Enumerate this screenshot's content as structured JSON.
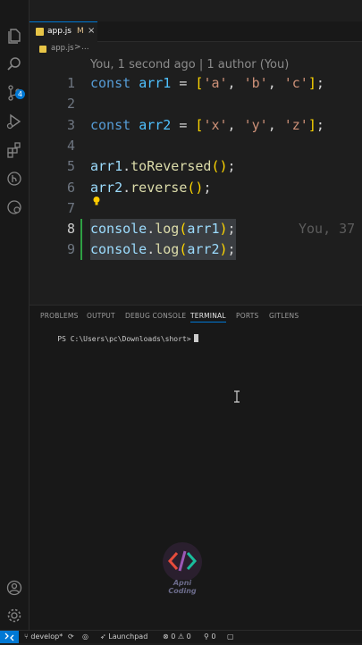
{
  "tab": {
    "filename": "app.js",
    "modified_flag": "M",
    "close_glyph": "×"
  },
  "breadcrumb": {
    "filename": "app.js",
    "separator": ">",
    "more": "..."
  },
  "editor": {
    "codelens": "You, 1 second ago | 1 author (You)",
    "blame": "You, 37",
    "lines": [
      {
        "n": "1",
        "tokens": [
          [
            "k",
            "const "
          ],
          [
            "v",
            "arr1"
          ],
          [
            "p",
            " = "
          ],
          [
            "b1",
            "["
          ],
          [
            "s",
            "'a'"
          ],
          [
            "p",
            ", "
          ],
          [
            "s",
            "'b'"
          ],
          [
            "p",
            ", "
          ],
          [
            "s",
            "'c'"
          ],
          [
            "b1",
            "]"
          ],
          [
            "p",
            ";"
          ]
        ]
      },
      {
        "n": "2",
        "tokens": []
      },
      {
        "n": "3",
        "tokens": [
          [
            "k",
            "const "
          ],
          [
            "v",
            "arr2"
          ],
          [
            "p",
            " = "
          ],
          [
            "b1",
            "["
          ],
          [
            "s",
            "'x'"
          ],
          [
            "p",
            ", "
          ],
          [
            "s",
            "'y'"
          ],
          [
            "p",
            ", "
          ],
          [
            "s",
            "'z'"
          ],
          [
            "b1",
            "]"
          ],
          [
            "p",
            ";"
          ]
        ]
      },
      {
        "n": "4",
        "tokens": []
      },
      {
        "n": "5",
        "tokens": [
          [
            "vl",
            "arr1"
          ],
          [
            "p",
            "."
          ],
          [
            "f",
            "toReversed"
          ],
          [
            "b1",
            "()"
          ],
          [
            "p",
            ";"
          ]
        ]
      },
      {
        "n": "6",
        "tokens": [
          [
            "vl",
            "arr2"
          ],
          [
            "p",
            "."
          ],
          [
            "f",
            "reverse"
          ],
          [
            "b1",
            "()"
          ],
          [
            "p",
            ";"
          ]
        ]
      },
      {
        "n": "7",
        "tokens": []
      },
      {
        "n": "8",
        "tokens": [
          [
            "vl",
            "console"
          ],
          [
            "p",
            "."
          ],
          [
            "f",
            "log"
          ],
          [
            "b1",
            "("
          ],
          [
            "vl",
            "arr1"
          ],
          [
            "b1",
            ")"
          ],
          [
            "p",
            ";"
          ]
        ]
      },
      {
        "n": "9",
        "tokens": [
          [
            "vl",
            "console"
          ],
          [
            "p",
            "."
          ],
          [
            "f",
            "log"
          ],
          [
            "b1",
            "("
          ],
          [
            "vl",
            "arr2"
          ],
          [
            "b1",
            ")"
          ],
          [
            "p",
            ";"
          ]
        ]
      }
    ]
  },
  "panel": {
    "tabs": [
      "PROBLEMS",
      "OUTPUT",
      "DEBUG CONSOLE",
      "TERMINAL",
      "PORTS",
      "GITLENS"
    ],
    "active_tab": "TERMINAL",
    "terminal_prompt": "PS C:\\Users\\pc\\Downloads\\short>"
  },
  "watermark": {
    "line1": "Apni",
    "line2": "Coding"
  },
  "statusbar": {
    "branch": "develop*",
    "launchpad": "Launchpad",
    "errors": "0",
    "warnings": "0",
    "ports": "0"
  },
  "activity": {
    "scm_badge": "4"
  },
  "colors": {
    "accent": "#0078d4",
    "editor_bg": "#1e1e1e",
    "keyword": "#569cd6",
    "string": "#ce9178",
    "function": "#dcdcaa"
  }
}
